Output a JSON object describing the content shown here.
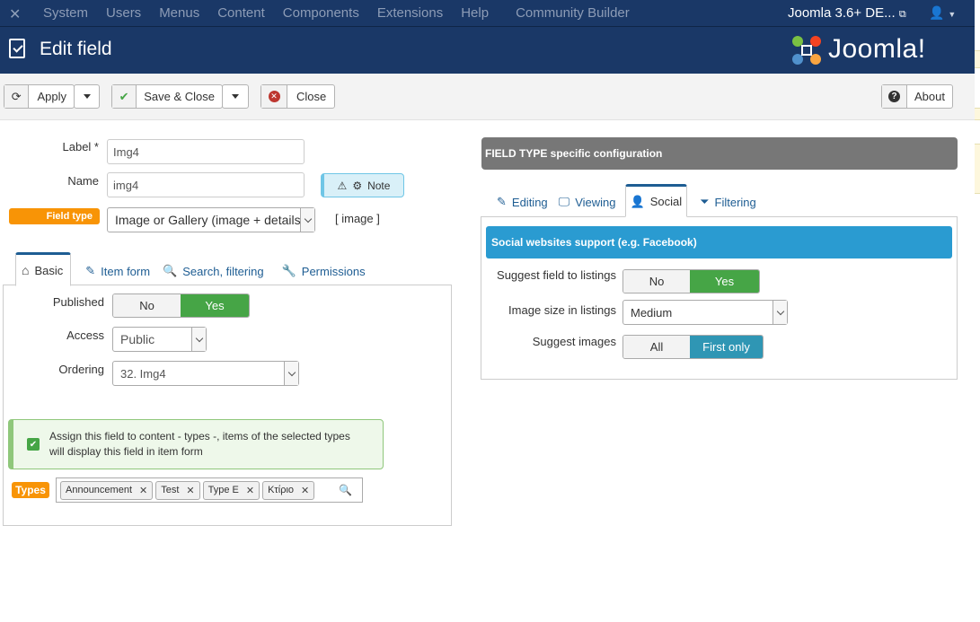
{
  "topnav": {
    "logo_icon": "joomla-x-icon",
    "menu": [
      "System",
      "Users",
      "Menus",
      "Content",
      "Components",
      "Extensions",
      "Help",
      "Community Builder"
    ],
    "site_label": "Joomla 3.6+ DE...",
    "user_icon": "user-icon"
  },
  "header": {
    "title": "Edit field",
    "brand": "Joomla!",
    "bg_color": "#1a3867"
  },
  "toolbar": {
    "apply": "Apply",
    "save_close": "Save & Close",
    "close": "Close",
    "about": "About"
  },
  "form": {
    "label_label": "Label *",
    "label_value": "Img4",
    "name_label": "Name",
    "name_value": "img4",
    "note_label": "Note",
    "field_type_badge": "Field type",
    "field_type_value": "Image or Gallery (image + details)",
    "field_type_code": "[ image ]"
  },
  "left_tabs": [
    {
      "label": "Basic",
      "icon": "home-icon",
      "active": true
    },
    {
      "label": "Item form",
      "icon": "edit-icon",
      "active": false
    },
    {
      "label": "Search, filtering",
      "icon": "search-icon",
      "active": false
    },
    {
      "label": "Permissions",
      "icon": "wrench-icon",
      "active": false
    }
  ],
  "basic": {
    "published_label": "Published",
    "published_no": "No",
    "published_yes": "Yes",
    "access_label": "Access",
    "access_value": "Public",
    "ordering_label": "Ordering",
    "ordering_value": "32. Img4",
    "assign_text_1": "Assign this field to content - types -, items of the selected types",
    "assign_text_2": "will display this field in item form",
    "types_badge": "Types",
    "types": [
      "Announcement",
      "Test",
      "Type E",
      "Κτίριο"
    ]
  },
  "right": {
    "header": "FIELD TYPE specific configuration",
    "tabs": [
      {
        "label": "Editing",
        "icon": "edit-icon",
        "active": false
      },
      {
        "label": "Viewing",
        "icon": "monitor-icon",
        "active": false
      },
      {
        "label": "Social",
        "icon": "user-icon",
        "active": true
      },
      {
        "label": "Filtering",
        "icon": "filter-icon",
        "active": false
      }
    ],
    "social_header": "Social websites support (e.g. Facebook)",
    "suggest_listings_label": "Suggest field to listings",
    "suggest_no": "No",
    "suggest_yes": "Yes",
    "image_size_label": "Image size in listings",
    "image_size_value": "Medium",
    "suggest_images_label": "Suggest images",
    "suggest_all": "All",
    "suggest_first": "First only"
  }
}
